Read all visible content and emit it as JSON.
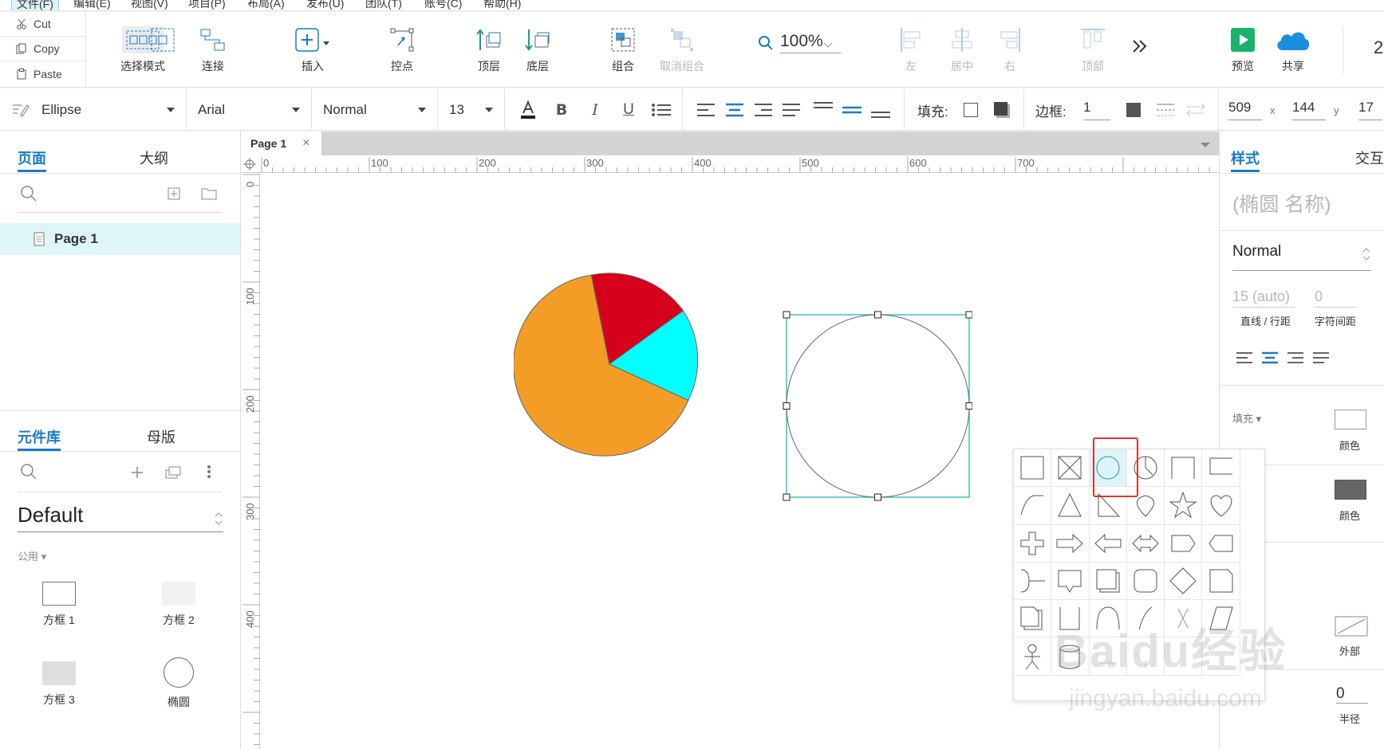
{
  "menubar": {
    "items": [
      "文件(F)",
      "编辑(E)",
      "视图(V)",
      "项目(P)",
      "布局(A)",
      "发布(U)",
      "团队(T)",
      "账号(C)",
      "帮助(H)"
    ]
  },
  "clipboard": {
    "cut": "Cut",
    "copy": "Copy",
    "paste": "Paste"
  },
  "toolbar": {
    "select_mode": "选择模式",
    "connect": "连接",
    "insert": "插入",
    "points": "控点",
    "front": "顶层",
    "back": "底层",
    "group": "组合",
    "ungroup": "取消组合",
    "zoom": "100%",
    "align_left": "左",
    "align_center": "居中",
    "align_right": "右",
    "align_top": "顶部",
    "preview": "预览",
    "share": "共享",
    "overflow": "2"
  },
  "format": {
    "shape": "Ellipse",
    "font": "Arial",
    "weight": "Normal",
    "size": "13",
    "fill_label": "填充:",
    "border_label": "边框:",
    "border_value": "1",
    "x": "509",
    "x_label": "x",
    "y": "144",
    "y_label": "y",
    "w": "17"
  },
  "left": {
    "tab_pages": "页面",
    "tab_outline": "大纲",
    "page_name": "Page 1",
    "tab_library": "元件库",
    "tab_masters": "母版",
    "library": "Default",
    "group": "公用 ▾",
    "widgets": [
      "方框 1",
      "方框 2",
      "方框 3",
      "椭圆"
    ]
  },
  "canvas": {
    "page_tab": "Page 1",
    "close": "×",
    "ruler_top": [
      "0",
      "100",
      "200",
      "300",
      "400",
      "500",
      "600",
      "700"
    ],
    "ruler_left": [
      "0",
      "100",
      "200",
      "300",
      "400"
    ],
    "pie_colors": {
      "orange": "#f39c26",
      "red": "#d7001c",
      "cyan": "#00ffff"
    },
    "selection_color": "#35c6c6"
  },
  "right": {
    "tab_style": "样式",
    "tab_interact": "交互",
    "name_placeholder": "(椭圆 名称)",
    "style": "Normal",
    "line_height": "15 (auto)",
    "char_spacing": "0",
    "line_height_label": "直线 / 行距",
    "char_spacing_label": "字符间距",
    "fill_section": "填充 ▾",
    "color_label": "颜色",
    "color_label2": "颜色",
    "outside_label": "外部",
    "radius": "0",
    "radius_label": "半径"
  },
  "watermark": {
    "brand": "Baidu经验",
    "url": "jingyan.baidu.com"
  }
}
